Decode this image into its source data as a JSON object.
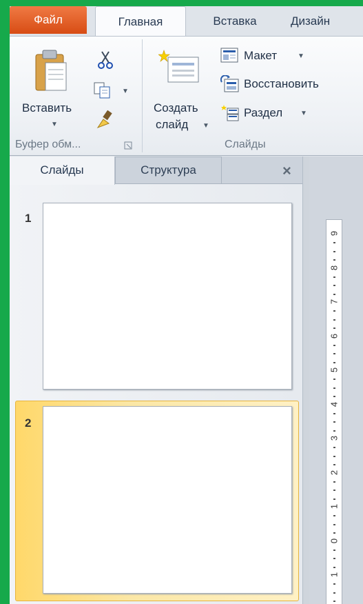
{
  "tabs": {
    "file": "Файл",
    "home": "Главная",
    "insert": "Вставка",
    "design": "Дизайн"
  },
  "clipboard": {
    "paste": "Вставить",
    "group_label": "Буфер обм..."
  },
  "slides_group": {
    "new_slide_line1": "Создать",
    "new_slide_line2": "слайд",
    "layout": "Макет",
    "reset": "Восстановить",
    "section": "Раздел",
    "group_label": "Слайды"
  },
  "pane": {
    "tab_slides": "Слайды",
    "tab_outline": "Структура",
    "close": "×",
    "slides": [
      {
        "number": "1",
        "selected": false
      },
      {
        "number": "2",
        "selected": true
      }
    ]
  },
  "ruler": {
    "labels": [
      "9",
      "8",
      "7",
      "6",
      "5",
      "4",
      "3",
      "2",
      "1",
      "0",
      "1"
    ]
  },
  "colors": {
    "file_tab": "#d74c14",
    "selection": "#ffd86a",
    "background": "#16a94b"
  }
}
